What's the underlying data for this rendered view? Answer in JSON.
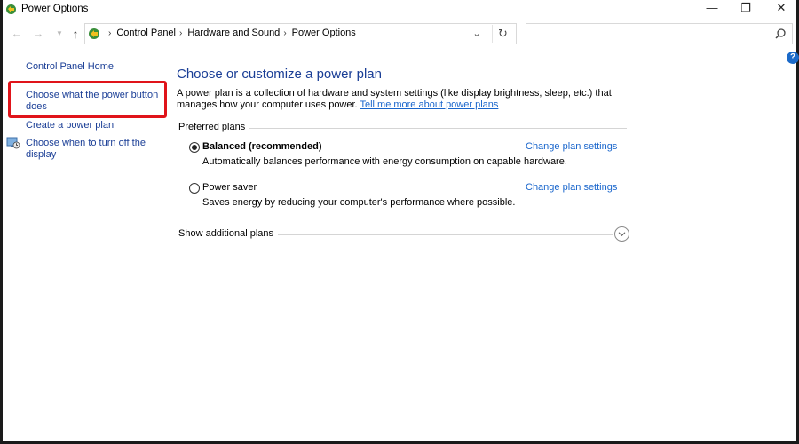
{
  "window": {
    "title": "Power Options",
    "controls": {
      "minimize": "—",
      "maximize": "❐",
      "close": "✕"
    }
  },
  "navbar": {
    "breadcrumbs": [
      "Control Panel",
      "Hardware and Sound",
      "Power Options"
    ],
    "search_placeholder": "",
    "icons": [
      "back-arrow-icon",
      "forward-arrow-icon",
      "recent-locations-icon",
      "up-arrow-icon",
      "control-panel-icon",
      "chevron-down-icon",
      "refresh-icon",
      "search-icon"
    ]
  },
  "help_icon": "?",
  "sidebar": {
    "home": "Control Panel Home",
    "items": [
      {
        "label": "Choose what the power button does",
        "highlighted": true
      },
      {
        "label": "Create a power plan"
      },
      {
        "label": "Choose when to turn off the display",
        "icon": "display-power-icon"
      }
    ]
  },
  "main": {
    "title": "Choose or customize a power plan",
    "intro_text": "A power plan is a collection of hardware and system settings (like display brightness, sleep, etc.) that manages how your computer uses power.",
    "intro_link": "Tell me more about power plans",
    "preferred_label": "Preferred plans",
    "plans": [
      {
        "name": "Balanced (recommended)",
        "selected": true,
        "description": "Automatically balances performance with energy consumption on capable hardware.",
        "change_link": "Change plan settings"
      },
      {
        "name": "Power saver",
        "selected": false,
        "description": "Saves energy by reducing your computer's performance where possible.",
        "change_link": "Change plan settings"
      }
    ],
    "additional_label": "Show additional plans"
  },
  "colors": {
    "link": "#1a66cc",
    "heading": "#1a3e96",
    "highlight": "#e0141a"
  }
}
